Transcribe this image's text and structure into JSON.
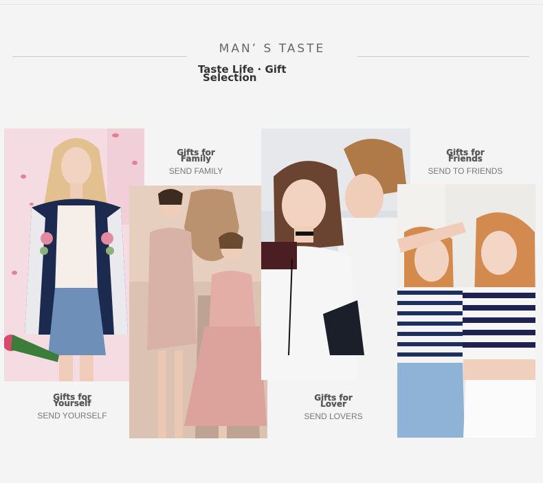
{
  "header": {
    "title": "MAN’ S TASTE",
    "subtitle_line1": "Taste Life · Gift",
    "subtitle_line2": "Selection"
  },
  "gifts": {
    "yourself": {
      "title_line1": "Gifts for",
      "title_line2": "Yourself",
      "subtitle": "SEND YOURSELF"
    },
    "family": {
      "title_line1": "Gifts for",
      "title_line2": "Family",
      "subtitle": "SEND FAMILY"
    },
    "lover": {
      "title_line1": "Gifts for",
      "title_line2": "Lover",
      "subtitle": "SEND LOVERS"
    },
    "friends": {
      "title_line1": "Gifts for",
      "title_line2": "Friends",
      "subtitle": "SEND TO FRIENDS"
    }
  },
  "colors": {
    "background": "#f4f4f4",
    "title": "#666666",
    "label": "#555555",
    "subtitle_text": "#777777"
  }
}
